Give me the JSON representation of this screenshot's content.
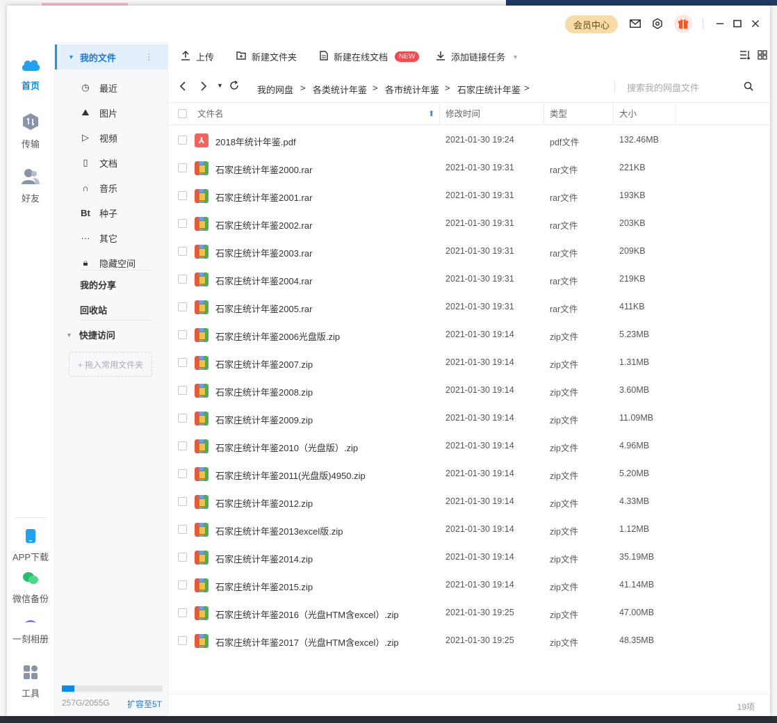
{
  "titlebar": {
    "vip_label": "会员中心"
  },
  "rail": {
    "home": "首页",
    "transfer": "传输",
    "friends": "好友",
    "app_download": "APP下载",
    "wechat_backup": "微信备份",
    "moment_album": "一刻相册",
    "tools": "工具"
  },
  "sidebar": {
    "my_files": "我的文件",
    "items": [
      {
        "icon": "clock-icon",
        "glyph": "◷",
        "label": "最近"
      },
      {
        "icon": "image-icon",
        "glyph": "⛰",
        "label": "图片"
      },
      {
        "icon": "play-icon",
        "glyph": "▷",
        "label": "视频"
      },
      {
        "icon": "document-icon",
        "glyph": "▯",
        "label": "文档"
      },
      {
        "icon": "headphone-icon",
        "glyph": "∩",
        "label": "音乐"
      },
      {
        "icon": "bt-icon",
        "glyph": "Bt",
        "label": "种子"
      },
      {
        "icon": "more-icon",
        "glyph": "···",
        "label": "其它"
      },
      {
        "icon": "lock-icon",
        "glyph": "🔒︎",
        "label": "隐藏空间"
      }
    ],
    "my_share": "我的分享",
    "recycle_bin": "回收站",
    "quick_access": "快捷访问",
    "drop_hint": "+ 拖入常用文件夹",
    "quota_text": "257G/2055G",
    "quota_fraction": 0.125,
    "upgrade": "扩容至5T"
  },
  "toolbar": {
    "upload": "上传",
    "new_folder": "新建文件夹",
    "new_online_doc": "新建在线文档",
    "new_badge": "NEW",
    "add_link_task": "添加链接任务"
  },
  "breadcrumb": [
    "我的网盘",
    "各类统计年鉴",
    "各市统计年鉴",
    "石家庄统计年鉴"
  ],
  "search": {
    "placeholder": "搜索我的网盘文件"
  },
  "table": {
    "columns": [
      "文件名",
      "修改时间",
      "类型",
      "大小"
    ],
    "rows": [
      {
        "name": "2018年统计年鉴.pdf",
        "date": "2021-01-30 19:24",
        "type": "pdf文件",
        "size": "132.46MB",
        "kind": "pdf"
      },
      {
        "name": "石家庄统计年鉴2000.rar",
        "date": "2021-01-30 19:31",
        "type": "rar文件",
        "size": "221KB",
        "kind": "rar"
      },
      {
        "name": "石家庄统计年鉴2001.rar",
        "date": "2021-01-30 19:31",
        "type": "rar文件",
        "size": "193KB",
        "kind": "rar"
      },
      {
        "name": "石家庄统计年鉴2002.rar",
        "date": "2021-01-30 19:31",
        "type": "rar文件",
        "size": "203KB",
        "kind": "rar"
      },
      {
        "name": "石家庄统计年鉴2003.rar",
        "date": "2021-01-30 19:31",
        "type": "rar文件",
        "size": "209KB",
        "kind": "rar"
      },
      {
        "name": "石家庄统计年鉴2004.rar",
        "date": "2021-01-30 19:31",
        "type": "rar文件",
        "size": "219KB",
        "kind": "rar"
      },
      {
        "name": "石家庄统计年鉴2005.rar",
        "date": "2021-01-30 19:31",
        "type": "rar文件",
        "size": "411KB",
        "kind": "rar"
      },
      {
        "name": "石家庄统计年鉴2006光盘版.zip",
        "date": "2021-01-30 19:14",
        "type": "zip文件",
        "size": "5.23MB",
        "kind": "rar"
      },
      {
        "name": "石家庄统计年鉴2007.zip",
        "date": "2021-01-30 19:14",
        "type": "zip文件",
        "size": "1.31MB",
        "kind": "rar"
      },
      {
        "name": "石家庄统计年鉴2008.zip",
        "date": "2021-01-30 19:14",
        "type": "zip文件",
        "size": "3.60MB",
        "kind": "rar"
      },
      {
        "name": "石家庄统计年鉴2009.zip",
        "date": "2021-01-30 19:14",
        "type": "zip文件",
        "size": "11.09MB",
        "kind": "rar"
      },
      {
        "name": "石家庄统计年鉴2010（光盘版）.zip",
        "date": "2021-01-30 19:14",
        "type": "zip文件",
        "size": "4.96MB",
        "kind": "rar"
      },
      {
        "name": "石家庄统计年鉴2011(光盘版)4950.zip",
        "date": "2021-01-30 19:14",
        "type": "zip文件",
        "size": "5.20MB",
        "kind": "rar"
      },
      {
        "name": "石家庄统计年鉴2012.zip",
        "date": "2021-01-30 19:14",
        "type": "zip文件",
        "size": "4.33MB",
        "kind": "rar"
      },
      {
        "name": "石家庄统计年鉴2013excel版.zip",
        "date": "2021-01-30 19:14",
        "type": "zip文件",
        "size": "1.12MB",
        "kind": "rar"
      },
      {
        "name": "石家庄统计年鉴2014.zip",
        "date": "2021-01-30 19:14",
        "type": "zip文件",
        "size": "35.19MB",
        "kind": "rar"
      },
      {
        "name": "石家庄统计年鉴2015.zip",
        "date": "2021-01-30 19:14",
        "type": "zip文件",
        "size": "41.14MB",
        "kind": "rar"
      },
      {
        "name": "石家庄统计年鉴2016（光盘HTM含excel）.zip",
        "date": "2021-01-30 19:25",
        "type": "zip文件",
        "size": "47.00MB",
        "kind": "rar"
      },
      {
        "name": "石家庄统计年鉴2017（光盘HTM含excel）.zip",
        "date": "2021-01-30 19:25",
        "type": "zip文件",
        "size": "48.35MB",
        "kind": "rar"
      }
    ]
  },
  "footer": {
    "count": "19项"
  },
  "colors": {
    "accent": "#2b8fe8",
    "vip": "#f7dca8",
    "badge": "#f04b50"
  }
}
